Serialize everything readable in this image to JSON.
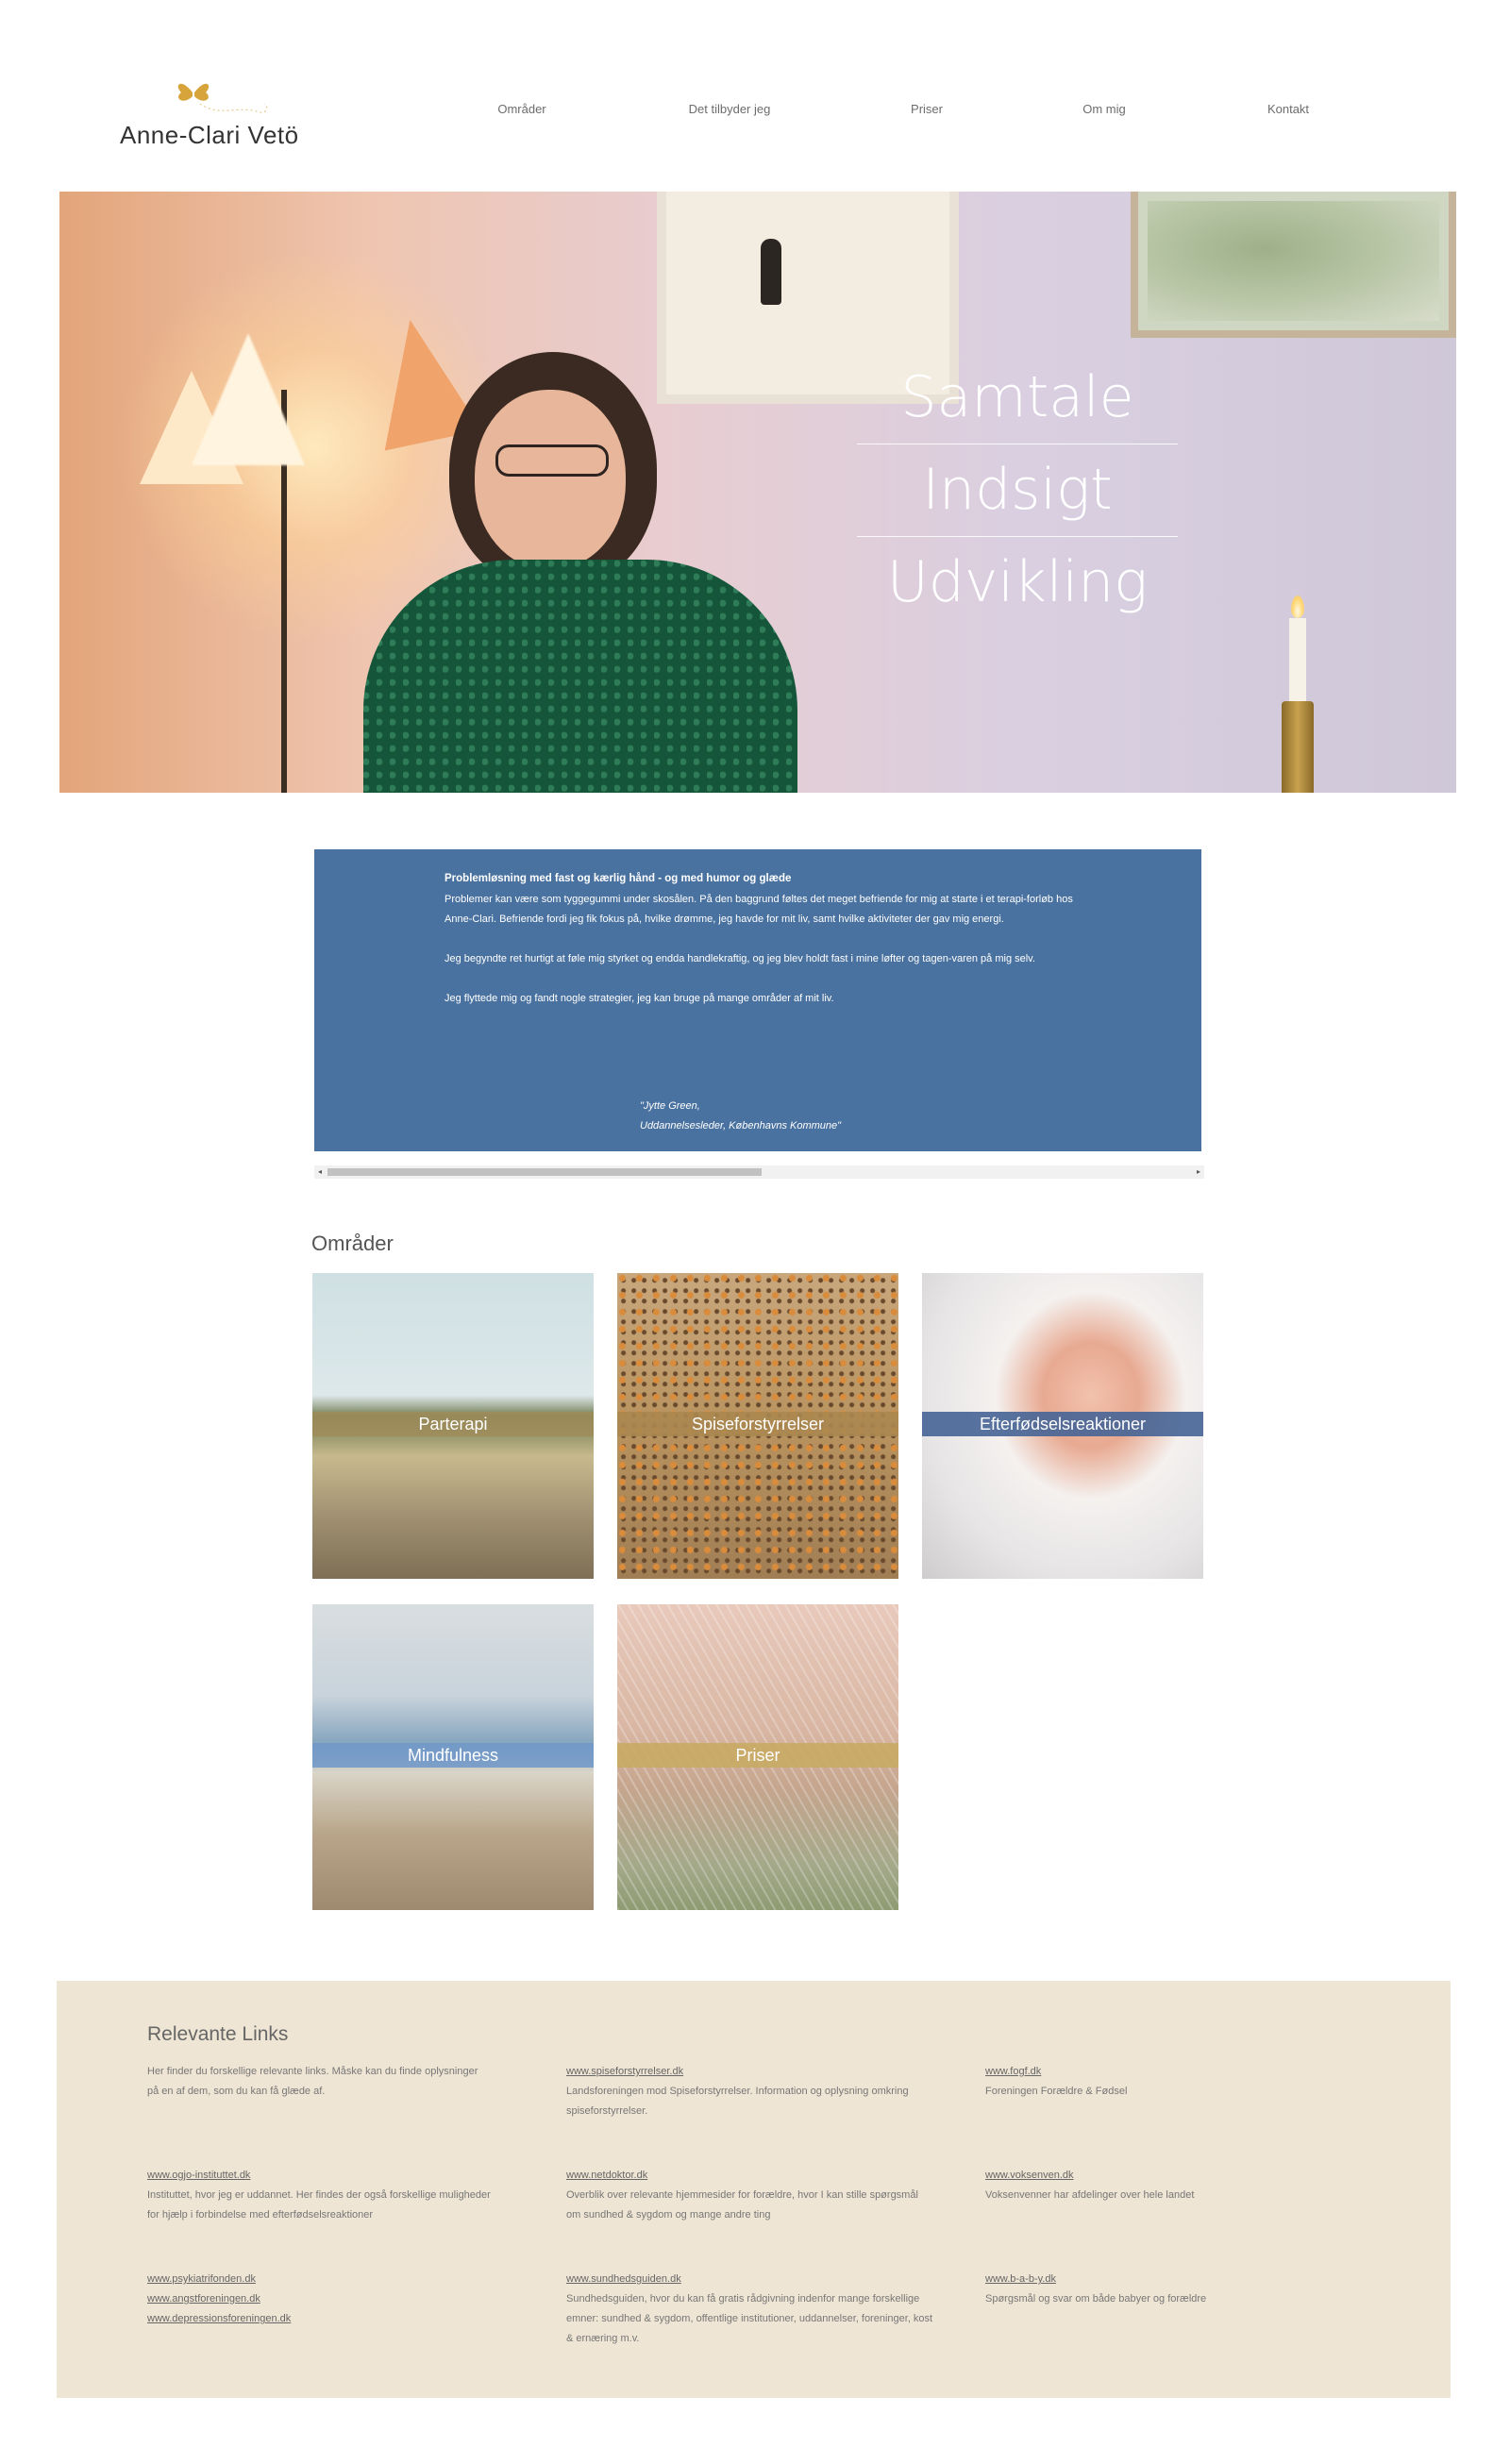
{
  "brand": {
    "name": "Anne-Clari Vetö",
    "icon": "butterfly-icon",
    "icon_color": "#d6a43a"
  },
  "nav": [
    "Områder",
    "Det tilbyder jeg",
    "Priser",
    "Om mig",
    "Kontakt"
  ],
  "hero": {
    "words": [
      "Samtale",
      "Indsigt",
      "Udvikling"
    ]
  },
  "testimonial": {
    "title": "Problemløsning med fast og kærlig hånd - og med humor og glæde",
    "paragraphs": [
      "Problemer kan være som tyggegummi under skosålen. På den baggrund føltes det meget befriende for mig at starte i et terapi-forløb hos Anne-Clari. Befriende fordi jeg fik fokus på, hvilke drømme, jeg havde for mit liv, samt hvilke aktiviteter der gav mig energi.",
      "Jeg begyndte ret hurtigt at føle mig styrket og endda handlekraftig, og jeg blev holdt fast i mine løfter og tagen-varen på mig selv.",
      "Jeg flyttede mig og fandt nogle strategier, jeg kan bruge på mange områder af mit liv."
    ],
    "signature_name": "\"Jytte Green,",
    "signature_role": "Uddannelsesleder, Københavns Kommune\"",
    "bg_color": "#4a72a0"
  },
  "areas": {
    "title": "Områder",
    "tiles": [
      "Parterapi",
      "Spiseforstyrrelser",
      "Efterfødselsreaktioner",
      "Mindfulness",
      "Priser"
    ]
  },
  "footer": {
    "title": "Relevante Links",
    "intro": "Her finder du forskellige relevante links. Måske kan du finde oplysninger på en af dem, som du kan få glæde af.",
    "items": [
      {
        "links": [
          "www.spiseforstyrrelser.dk"
        ],
        "text": "Landsforeningen mod Spiseforstyrrelser. Information og oplysning omkring spiseforstyrrelser."
      },
      {
        "links": [
          "www.fogf.dk"
        ],
        "text": "Foreningen Forældre & Fødsel"
      },
      {
        "links": [
          "www.ogjo-instituttet.dk"
        ],
        "text": "Instituttet, hvor jeg er uddannet. Her findes der også forskellige muligheder for hjælp i forbindelse med efterfødselsreaktioner"
      },
      {
        "links": [
          "www.netdoktor.dk"
        ],
        "text": "Overblik over relevante hjemmesider for forældre, hvor I kan stille spørgsmål om sundhed & sygdom og mange andre ting"
      },
      {
        "links": [
          "www.voksenven.dk"
        ],
        "text": "Voksenvenner har afdelinger over hele landet"
      },
      {
        "links": [
          "www.psykiatrifonden.dk",
          "www.angstforeningen.dk",
          "www.depressionsforeningen.dk"
        ],
        "text": ""
      },
      {
        "links": [
          "www.sundhedsguiden.dk"
        ],
        "text": "Sundhedsguiden, hvor du kan få gratis rådgivning indenfor mange forskellige emner: sundhed & sygdom, offentlige institutioner, uddannelser, foreninger, kost & ernæring m.v."
      },
      {
        "links": [
          "www.b-a-b-y.dk"
        ],
        "text": "Spørgsmål og svar om både babyer og forældre"
      }
    ],
    "bg_color": "#efe5d4"
  }
}
